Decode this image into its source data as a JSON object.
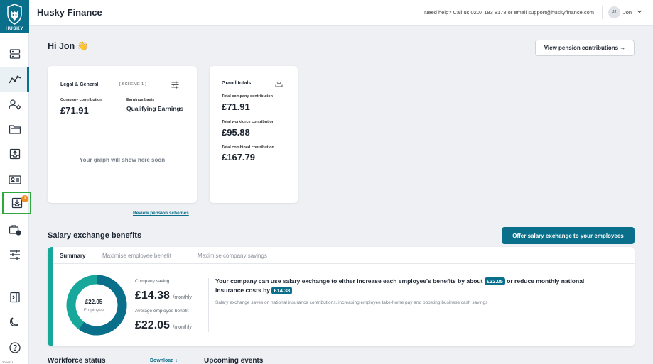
{
  "sidebar": {
    "brand": "HUSKY",
    "items": [
      {
        "name": "dashboard",
        "icon": "server-icon"
      },
      {
        "name": "analytics",
        "icon": "chart-line-icon",
        "active": true
      },
      {
        "name": "people",
        "icon": "people-settings-icon"
      },
      {
        "name": "documents",
        "icon": "folder-icon"
      },
      {
        "name": "upload",
        "icon": "upload-tray-icon"
      },
      {
        "name": "id-card",
        "icon": "id-card-icon"
      },
      {
        "name": "inbox",
        "icon": "download-tray-icon",
        "badge": "1"
      },
      {
        "name": "schedule",
        "icon": "briefcase-clock-icon"
      },
      {
        "name": "settings",
        "icon": "sliders-icon"
      },
      {
        "name": "collapse",
        "icon": "sidebar-toggle-icon"
      },
      {
        "name": "theme",
        "icon": "moon-icon"
      },
      {
        "name": "help",
        "icon": "help-icon"
      }
    ],
    "version": "2024031..."
  },
  "header": {
    "title": "Husky Finance",
    "help_text": "Need help? Call us 0207 183 8178 or email support@huskyfinance.com",
    "avatar_initials": "JJ",
    "user_name": "Jon"
  },
  "main": {
    "greeting": "Hi Jon 👋",
    "view_contributions_button": "View pension contributions →",
    "scheme_card": {
      "provider": "Legal & General",
      "scheme": "[ SCHEME-1 ]",
      "company_contribution_label": "Company contribution",
      "company_contribution_value": "£71.91",
      "earnings_basis_label": "Earnings basis",
      "earnings_basis_value": "Qualifying Earnings",
      "graph_placeholder": "Your graph will show here soon"
    },
    "grand_totals": {
      "title": "Grand totals",
      "company_label": "Total company contribution",
      "company_value": "£71.91",
      "workforce_label": "Total workforce contribution",
      "workforce_value": "£95.88",
      "combined_label": "Total combined contribution",
      "combined_value": "£167.79"
    },
    "review_link": "Review pension schemes"
  },
  "salary_exchange": {
    "title": "Salary exchange benefits",
    "offer_button": "Offer salary exchange to your employees",
    "tabs": [
      "Summary",
      "Maximise employee benefit",
      "Maximise company savings"
    ],
    "donut_value": "£22.05",
    "donut_label": "Employee",
    "donut_fraction": 0.6,
    "company_saving_label": "Company saving",
    "company_saving_value": "£14.38",
    "unit": "/monthly",
    "avg_benefit_label": "Average employee benefit",
    "avg_benefit_value": "£22.05",
    "headline_a": "Your company can use salary exchange to either increase each employee's benefits by about",
    "headline_pill1": "£22.05",
    "headline_b": "or reduce monthly national insurance costs by",
    "headline_pill2": "£14.38",
    "subtext": "Salary exchange saves on national insurance contributions, increasing employee take-home pay and boosting business cash savings"
  },
  "bottom": {
    "workforce_title": "Workforce status",
    "download_link": "Download ↓",
    "events_title": "Upcoming events"
  },
  "colors": {
    "brand": "#0a6f8a",
    "accent": "#17a89b",
    "badge": "#f08b1f",
    "highlight": "#2fa83c"
  }
}
